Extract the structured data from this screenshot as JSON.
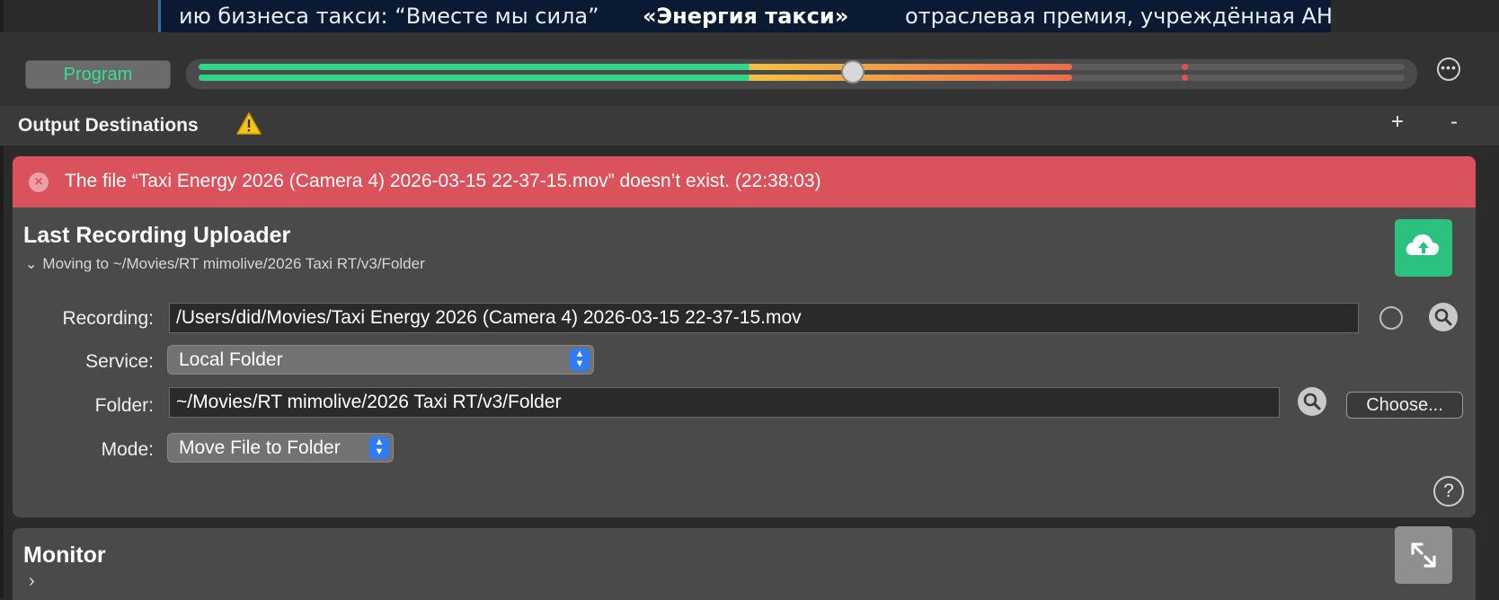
{
  "ticker": {
    "segment1": "ию бизнеса такси: “Вместе мы сила”",
    "segment2": "«Энергия такси»",
    "segment3": "отраслевая премия, учреждённая АН"
  },
  "topbar": {
    "program_label": "Program",
    "meter_level": 0.54,
    "more_icon": "ellipsis-circle-icon"
  },
  "output_header": {
    "title": "Output Destinations",
    "add_label": "+",
    "remove_label": "-"
  },
  "error": {
    "message": "The file “Taxi Energy 2026 (Camera 4) 2026-03-15 22-37-15.mov” doesn’t exist. (22:38:03)"
  },
  "uploader": {
    "title": "Last Recording Uploader",
    "subtitle": "Moving to ~/Movies/RT mimolive/2026 Taxi RT/v3/Folder",
    "recording_label": "Recording:",
    "recording_value": "/Users/did/Movies/Taxi Energy 2026 (Camera 4) 2026-03-15 22-37-15.mov",
    "service_label": "Service:",
    "service_value": "Local Folder",
    "folder_label": "Folder:",
    "folder_value": "~/Movies/RT mimolive/2026 Taxi RT/v3/Folder",
    "choose_label": "Choose...",
    "mode_label": "Mode:",
    "mode_value": "Move File to Folder",
    "help_label": "?"
  },
  "monitor": {
    "title": "Monitor"
  },
  "colors": {
    "error_bg": "#d9525c",
    "upload_accent": "#2bc27f",
    "meter_green": "#2fd687",
    "meter_yellow": "#f3c240",
    "meter_red": "#ee6a4d"
  }
}
